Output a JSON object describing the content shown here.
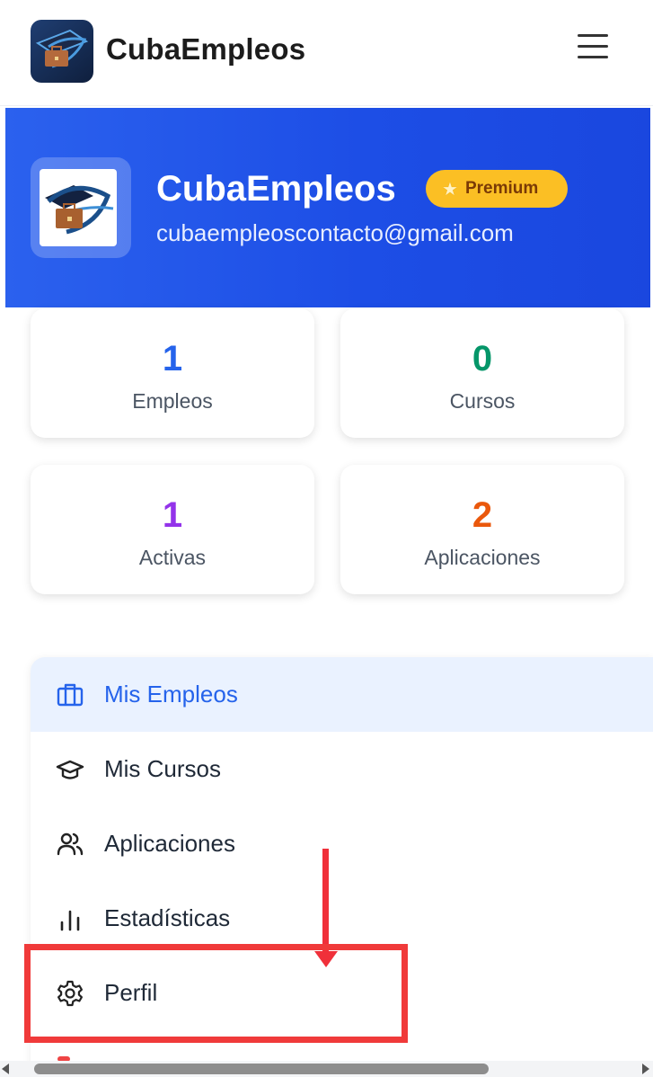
{
  "header": {
    "app_title": "CubaEmpleos",
    "logo_icon": "cubaempleos-logo-icon",
    "menu_icon": "hamburger-menu-icon"
  },
  "profile": {
    "name": "CubaEmpleos",
    "badge": "Premium",
    "badge_icon": "star-icon",
    "email": "cubaempleoscontacto@gmail.com"
  },
  "stats": [
    {
      "value": "1",
      "label": "Empleos",
      "color": "#2563eb"
    },
    {
      "value": "0",
      "label": "Cursos",
      "color": "#059669"
    },
    {
      "value": "1",
      "label": "Activas",
      "color": "#9333ea"
    },
    {
      "value": "2",
      "label": "Aplicaciones",
      "color": "#ea580c"
    }
  ],
  "menu": {
    "items": [
      {
        "label": "Mis Empleos",
        "icon": "briefcase-icon",
        "active": true
      },
      {
        "label": "Mis Cursos",
        "icon": "graduation-cap-icon",
        "active": false
      },
      {
        "label": "Aplicaciones",
        "icon": "users-icon",
        "active": false
      },
      {
        "label": "Estadísticas",
        "icon": "bar-chart-icon",
        "active": false
      },
      {
        "label": "Perfil",
        "icon": "settings-gear-icon",
        "active": false
      }
    ]
  },
  "colors": {
    "accent": "#2563eb",
    "hero_bg": "#1d4ee6",
    "premium_bg": "#fbbf24",
    "annotation": "#f0303a"
  }
}
